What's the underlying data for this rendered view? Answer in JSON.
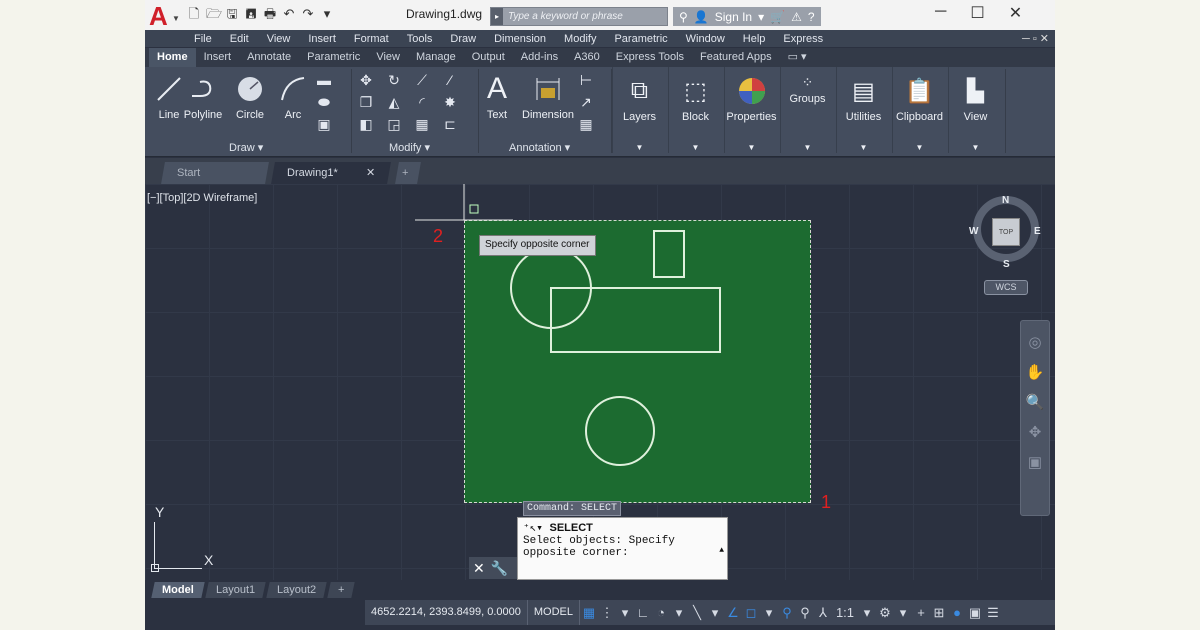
{
  "title_bar": {
    "document_title": "Drawing1.dwg",
    "search_placeholder": "Type a keyword or phrase",
    "sign_in": "Sign In",
    "qat_icons": [
      "new-icon",
      "open-icon",
      "save-icon",
      "save-as-icon",
      "print-icon",
      "undo-icon",
      "redo-icon"
    ]
  },
  "menu": [
    "File",
    "Edit",
    "View",
    "Insert",
    "Format",
    "Tools",
    "Draw",
    "Dimension",
    "Modify",
    "Parametric",
    "Window",
    "Help",
    "Express"
  ],
  "ribbon_tabs": [
    "Home",
    "Insert",
    "Annotate",
    "Parametric",
    "View",
    "Manage",
    "Output",
    "Add-ins",
    "A360",
    "Express Tools",
    "Featured Apps"
  ],
  "ribbon": {
    "draw_tools": [
      "Line",
      "Polyline",
      "Circle",
      "Arc"
    ],
    "draw_panel": "Draw",
    "modify_panel": "Modify",
    "annotation_tools": [
      "Text",
      "Dimension"
    ],
    "annotation_panel": "Annotation",
    "groups": [
      "Layers",
      "Block",
      "Properties",
      "Groups",
      "Utilities",
      "Clipboard",
      "View"
    ]
  },
  "file_tabs": [
    "Start",
    "Drawing1*"
  ],
  "viewport": {
    "label": "[−][Top][2D Wireframe]",
    "corner_label_1": "1",
    "corner_label_2": "2",
    "tooltip": "Specify opposite corner"
  },
  "command": {
    "tag": "Command: SELECT",
    "popup_cmd": "SELECT",
    "prompt_line1": "Select objects: Specify",
    "prompt_line2": "opposite corner:"
  },
  "viewcube": {
    "north": "N",
    "south": "S",
    "east": "E",
    "west": "W",
    "face": "TOP",
    "wcs": "WCS"
  },
  "ucs": {
    "x": "X",
    "y": "Y"
  },
  "layout_tabs": [
    "Model",
    "Layout1",
    "Layout2"
  ],
  "status": {
    "coords": "4652.2214, 2393.8499, 0.0000",
    "model": "MODEL",
    "scale": "1:1"
  }
}
